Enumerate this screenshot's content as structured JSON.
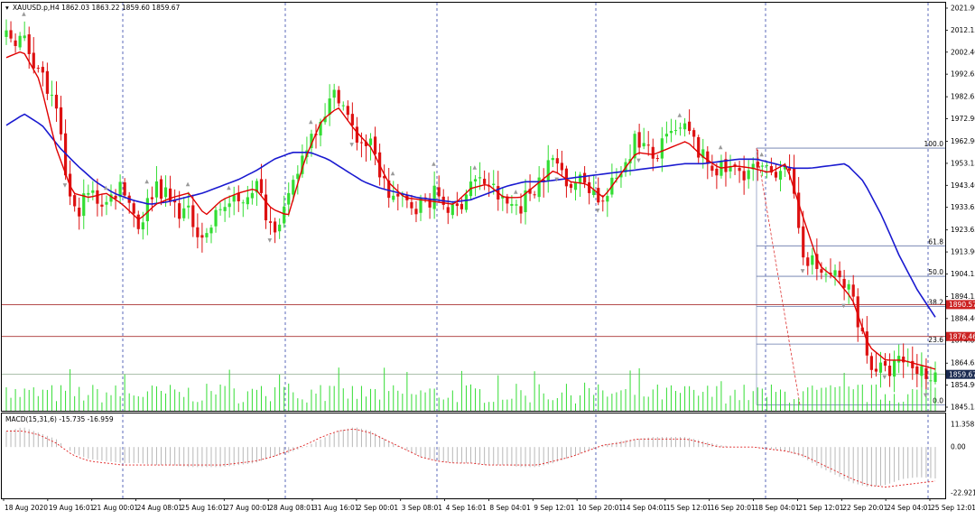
{
  "header": {
    "symbol_line": "XAUUSD.p,H4  1862.03 1863.22 1859.60 1859.67",
    "macd_line": "MACD(15,31,6) -15.735 -16.959"
  },
  "colors": {
    "bull": "#33dd33",
    "bear": "#dd1111",
    "ma_fast": "#e00000",
    "ma_slow": "#1a1ad0",
    "volume": "#33dd33",
    "grid_dash": "#3344aa",
    "hline": "#aa3333",
    "fib": "#6677aa",
    "current_price_bg": "#1a2a50",
    "hline_label_bg": "#cc2222"
  },
  "chart_data": {
    "type": "candlestick",
    "y_ticks": [
      "2021.90",
      "2012.15",
      "2002.40",
      "1992.65",
      "1982.65",
      "1972.90",
      "1962.90",
      "1953.15",
      "1943.40",
      "1933.65",
      "1923.65",
      "1913.90",
      "1904.15",
      "1894.15",
      "1884.40",
      "1874.65",
      "1864.65",
      "1854.90",
      "1845.15"
    ],
    "ylim": [
      1845.15,
      2021.9
    ],
    "x_labels": [
      "18 Aug 2020",
      "19 Aug 16:01",
      "21 Aug 00:01",
      "24 Aug 08:01",
      "25 Aug 16:01",
      "27 Aug 00:01",
      "28 Aug 08:01",
      "31 Aug 16:01",
      "2 Sep 00:01",
      "3 Sep 08:01",
      "4 Sep 16:01",
      "8 Sep 04:01",
      "9 Sep 12:01",
      "10 Sep 20:01",
      "14 Sep 04:01",
      "15 Sep 12:01",
      "16 Sep 20:01",
      "18 Sep 04:01",
      "21 Sep 12:01",
      "22 Sep 20:01",
      "24 Sep 04:01",
      "25 Sep 12:01"
    ],
    "price_anchors": [
      2010,
      2008,
      1995,
      1975,
      1930,
      1940,
      1935,
      1945,
      1925,
      1945,
      1935,
      1930,
      1920,
      1935,
      1935,
      1945,
      1925,
      1935,
      1960,
      1975,
      1985,
      1965,
      1960,
      1940,
      1935,
      1935,
      1940,
      1930,
      1945,
      1945,
      1935,
      1935,
      1945,
      1955,
      1945,
      1945,
      1935,
      1950,
      1965,
      1955,
      1965,
      1968,
      1955,
      1950,
      1950,
      1950,
      1948,
      1955,
      1915,
      1905,
      1903,
      1895,
      1865,
      1860,
      1866,
      1862,
      1859.67
    ],
    "ma_fast_anchors": [
      2000,
      2003,
      1990,
      1960,
      1940,
      1938,
      1940,
      1935,
      1928,
      1935,
      1938,
      1940,
      1930,
      1937,
      1940,
      1942,
      1933,
      1930,
      1955,
      1972,
      1978,
      1968,
      1960,
      1945,
      1938,
      1937,
      1936,
      1935,
      1942,
      1944,
      1938,
      1938,
      1944,
      1950,
      1945,
      1944,
      1938,
      1948,
      1958,
      1957,
      1960,
      1963,
      1956,
      1951,
      1952,
      1951,
      1949,
      1953,
      1930,
      1908,
      1902,
      1893,
      1872,
      1866,
      1866,
      1864,
      1862
    ],
    "ma_slow_anchors": [
      1970,
      1975,
      1970,
      1960,
      1952,
      1945,
      1940,
      1937,
      1935,
      1936,
      1938,
      1940,
      1943,
      1946,
      1950,
      1955,
      1958,
      1958,
      1955,
      1950,
      1945,
      1942,
      1940,
      1938,
      1937,
      1936,
      1937,
      1940,
      1943,
      1945,
      1945,
      1946,
      1947,
      1948,
      1949,
      1950,
      1951,
      1952,
      1953,
      1953,
      1954,
      1955,
      1955,
      1953,
      1951,
      1951,
      1952,
      1953,
      1945,
      1930,
      1912,
      1897,
      1885
    ],
    "horizontal_lines": [
      {
        "price": 1890.57,
        "label": "1890.57"
      },
      {
        "price": 1876.46,
        "label": "1876.46"
      }
    ],
    "current_price": {
      "price": 1859.67,
      "label": "1859.67"
    },
    "fibonacci": [
      {
        "level": "100.0",
        "price": 1959.9
      },
      {
        "level": "61.8",
        "price": 1916.6
      },
      {
        "level": "50.0",
        "price": 1903.1
      },
      {
        "level": "38.2",
        "price": 1889.7
      },
      {
        "level": "23.6",
        "price": 1873.1
      },
      {
        "level": "0.0",
        "price": 1846.2
      }
    ],
    "macd": {
      "y_ticks": [
        "11.358",
        "0.00",
        "-22.921"
      ],
      "ylim": [
        -22.921,
        11.358
      ],
      "hist_anchors": [
        8,
        10,
        7,
        4,
        -3,
        -6,
        -7,
        -8,
        -8,
        -9,
        -9,
        -10,
        -10,
        -10,
        -9,
        -8,
        -5,
        -3,
        0,
        4,
        8,
        10,
        8,
        3,
        -1,
        -5,
        -7,
        -8,
        -8,
        -9,
        -9,
        -10,
        -10,
        -8,
        -5,
        -2,
        1,
        3,
        4,
        5,
        5,
        5,
        3,
        1,
        0,
        0,
        -1,
        -2,
        -5,
        -10,
        -14,
        -18,
        -20,
        -19,
        -16,
        -15,
        -15.7
      ],
      "signal_anchors": [
        8,
        8,
        6,
        2,
        -4,
        -7,
        -8,
        -9,
        -9,
        -9,
        -9,
        -9,
        -9,
        -9,
        -8,
        -7,
        -5,
        -2,
        1,
        5,
        8,
        9,
        7,
        3,
        -1,
        -5,
        -7,
        -8,
        -8,
        -9,
        -9,
        -9,
        -9,
        -7,
        -5,
        -2,
        1,
        2,
        4,
        4,
        4,
        4,
        2,
        0,
        0,
        0,
        -1,
        -2,
        -4,
        -8,
        -12,
        -16,
        -19,
        -20,
        -19,
        -18,
        -17
      ]
    }
  }
}
